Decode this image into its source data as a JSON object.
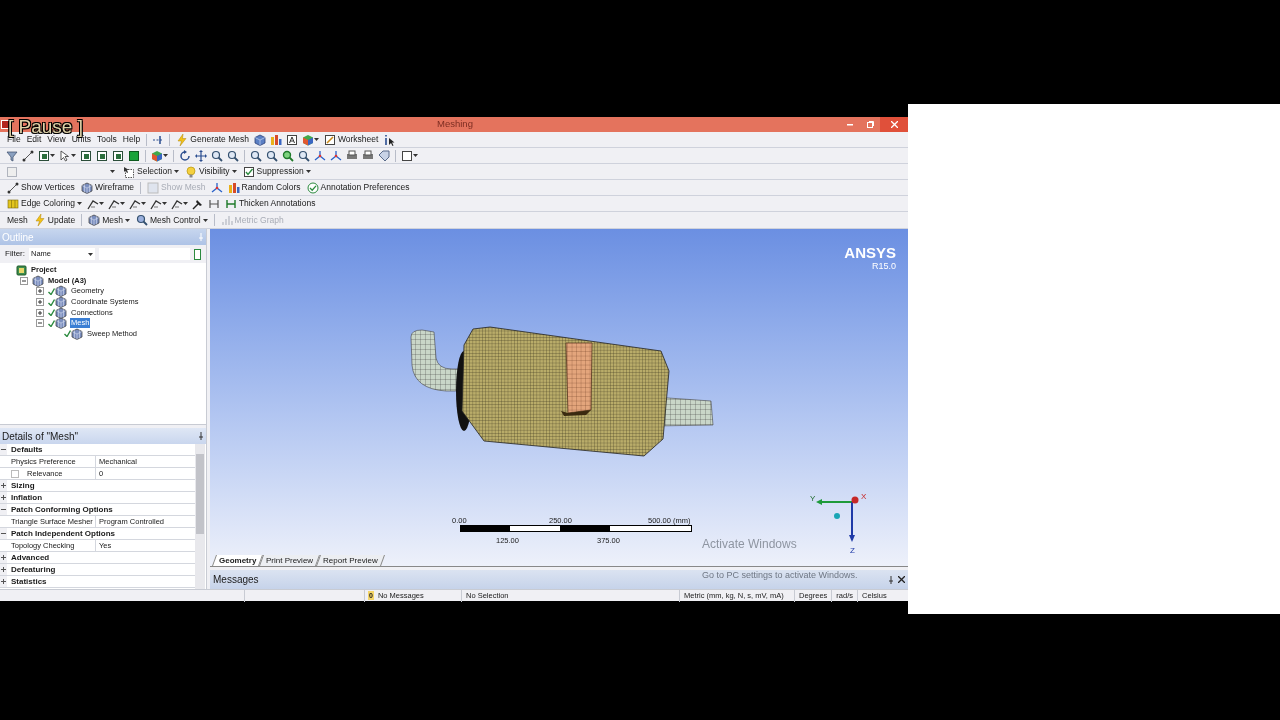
{
  "video_overlay": {
    "text": "[ Pause ]"
  },
  "window": {
    "title": "Meshing"
  },
  "menu_bar": {
    "items": [
      "File",
      "Edit",
      "View",
      "Units",
      "Tools",
      "Help"
    ],
    "generate": "Generate Mesh",
    "worksheet": "Worksheet"
  },
  "toolbar_rows": [
    {
      "items": [
        {
          "label": "Selection",
          "dropdown": true,
          "disabled": false
        },
        {
          "label": "Visibility",
          "dropdown": true,
          "disabled": false
        },
        {
          "label": "Suppression",
          "dropdown": true,
          "disabled": false
        }
      ]
    },
    {
      "items": [
        {
          "label": "Show Vertices",
          "dropdown": false,
          "disabled": false
        },
        {
          "label": "Wireframe",
          "dropdown": false,
          "disabled": false
        },
        {
          "label": "Show Mesh",
          "dropdown": false,
          "disabled": true
        },
        {
          "label": "Random Colors",
          "dropdown": false,
          "disabled": false
        },
        {
          "label": "Annotation Preferences",
          "dropdown": false,
          "disabled": false
        }
      ]
    },
    {
      "items": [
        {
          "label": "Edge Coloring",
          "dropdown": true,
          "disabled": false
        },
        {
          "label": "Thicken Annotations",
          "dropdown": false,
          "disabled": false
        }
      ]
    },
    {
      "items": [
        {
          "label": "Mesh",
          "dropdown": false,
          "disabled": false
        },
        {
          "label": "Update",
          "dropdown": false,
          "disabled": false
        },
        {
          "label": "Mesh",
          "dropdown": true,
          "disabled": false
        },
        {
          "label": "Mesh Control",
          "dropdown": true,
          "disabled": false
        },
        {
          "label": "Metric Graph",
          "dropdown": false,
          "disabled": true
        }
      ]
    }
  ],
  "outline": {
    "title": "Outline",
    "filter_label": "Filter:",
    "filter_value": "Name",
    "tree": [
      {
        "label": "Project",
        "selected": false,
        "children": [
          {
            "label": "Model (A3)",
            "expanded": true,
            "selected": false,
            "children": [
              {
                "label": "Geometry",
                "expanded": false,
                "checked": true,
                "selected": false
              },
              {
                "label": "Coordinate Systems",
                "expanded": false,
                "checked": true,
                "selected": false
              },
              {
                "label": "Connections",
                "expanded": false,
                "checked": true,
                "selected": false
              },
              {
                "label": "Mesh",
                "expanded": true,
                "checked": true,
                "selected": true,
                "children": [
                  {
                    "label": "Sweep Method",
                    "checked": true,
                    "selected": false
                  }
                ]
              }
            ]
          }
        ]
      }
    ]
  },
  "details": {
    "title": "Details of \"Mesh\"",
    "rows": [
      {
        "kind": "group",
        "label": "Defaults",
        "expanded": true
      },
      {
        "kind": "property",
        "label": "Physics Preference",
        "value": "Mechanical"
      },
      {
        "kind": "check_property",
        "label": "Relevance",
        "value": "0",
        "checked": false
      },
      {
        "kind": "group",
        "label": "Sizing",
        "expanded": false
      },
      {
        "kind": "group",
        "label": "Inflation",
        "expanded": false
      },
      {
        "kind": "group",
        "label": "Patch Conforming Options",
        "expanded": true
      },
      {
        "kind": "property",
        "label": "Triangle Surface Mesher",
        "value": "Program Controlled"
      },
      {
        "kind": "group",
        "label": "Patch Independent Options",
        "expanded": true
      },
      {
        "kind": "property",
        "label": "Topology Checking",
        "value": "Yes"
      },
      {
        "kind": "group",
        "label": "Advanced",
        "expanded": false
      },
      {
        "kind": "group",
        "label": "Defeaturing",
        "expanded": false
      },
      {
        "kind": "group",
        "label": "Statistics",
        "expanded": false
      }
    ]
  },
  "viewport": {
    "brand": "ANSYS",
    "version": "R15.0",
    "scale": {
      "top_labels": [
        "0.00",
        "250.00",
        "500.00 (mm)"
      ],
      "bottom_labels": [
        "125.00",
        "375.00"
      ]
    },
    "triad": {
      "labels": [
        "Y",
        "X",
        "Z"
      ]
    },
    "tabs": [
      {
        "label": "Geometry",
        "selected": true
      },
      {
        "label": "Print Preview",
        "selected": false
      },
      {
        "label": "Report Preview",
        "selected": false
      }
    ]
  },
  "activation_notice": {
    "title": "Activate Windows",
    "hint": "Go to PC settings to activate Windows."
  },
  "messages": {
    "title": "Messages"
  },
  "status_bar": {
    "message_count": "0",
    "messages": "No Messages",
    "selection": "No Selection",
    "units": "Metric (mm, kg, N, s, mV, mA)",
    "angle": "Degrees",
    "rotation": "rad/s",
    "temperature": "Celsius"
  }
}
